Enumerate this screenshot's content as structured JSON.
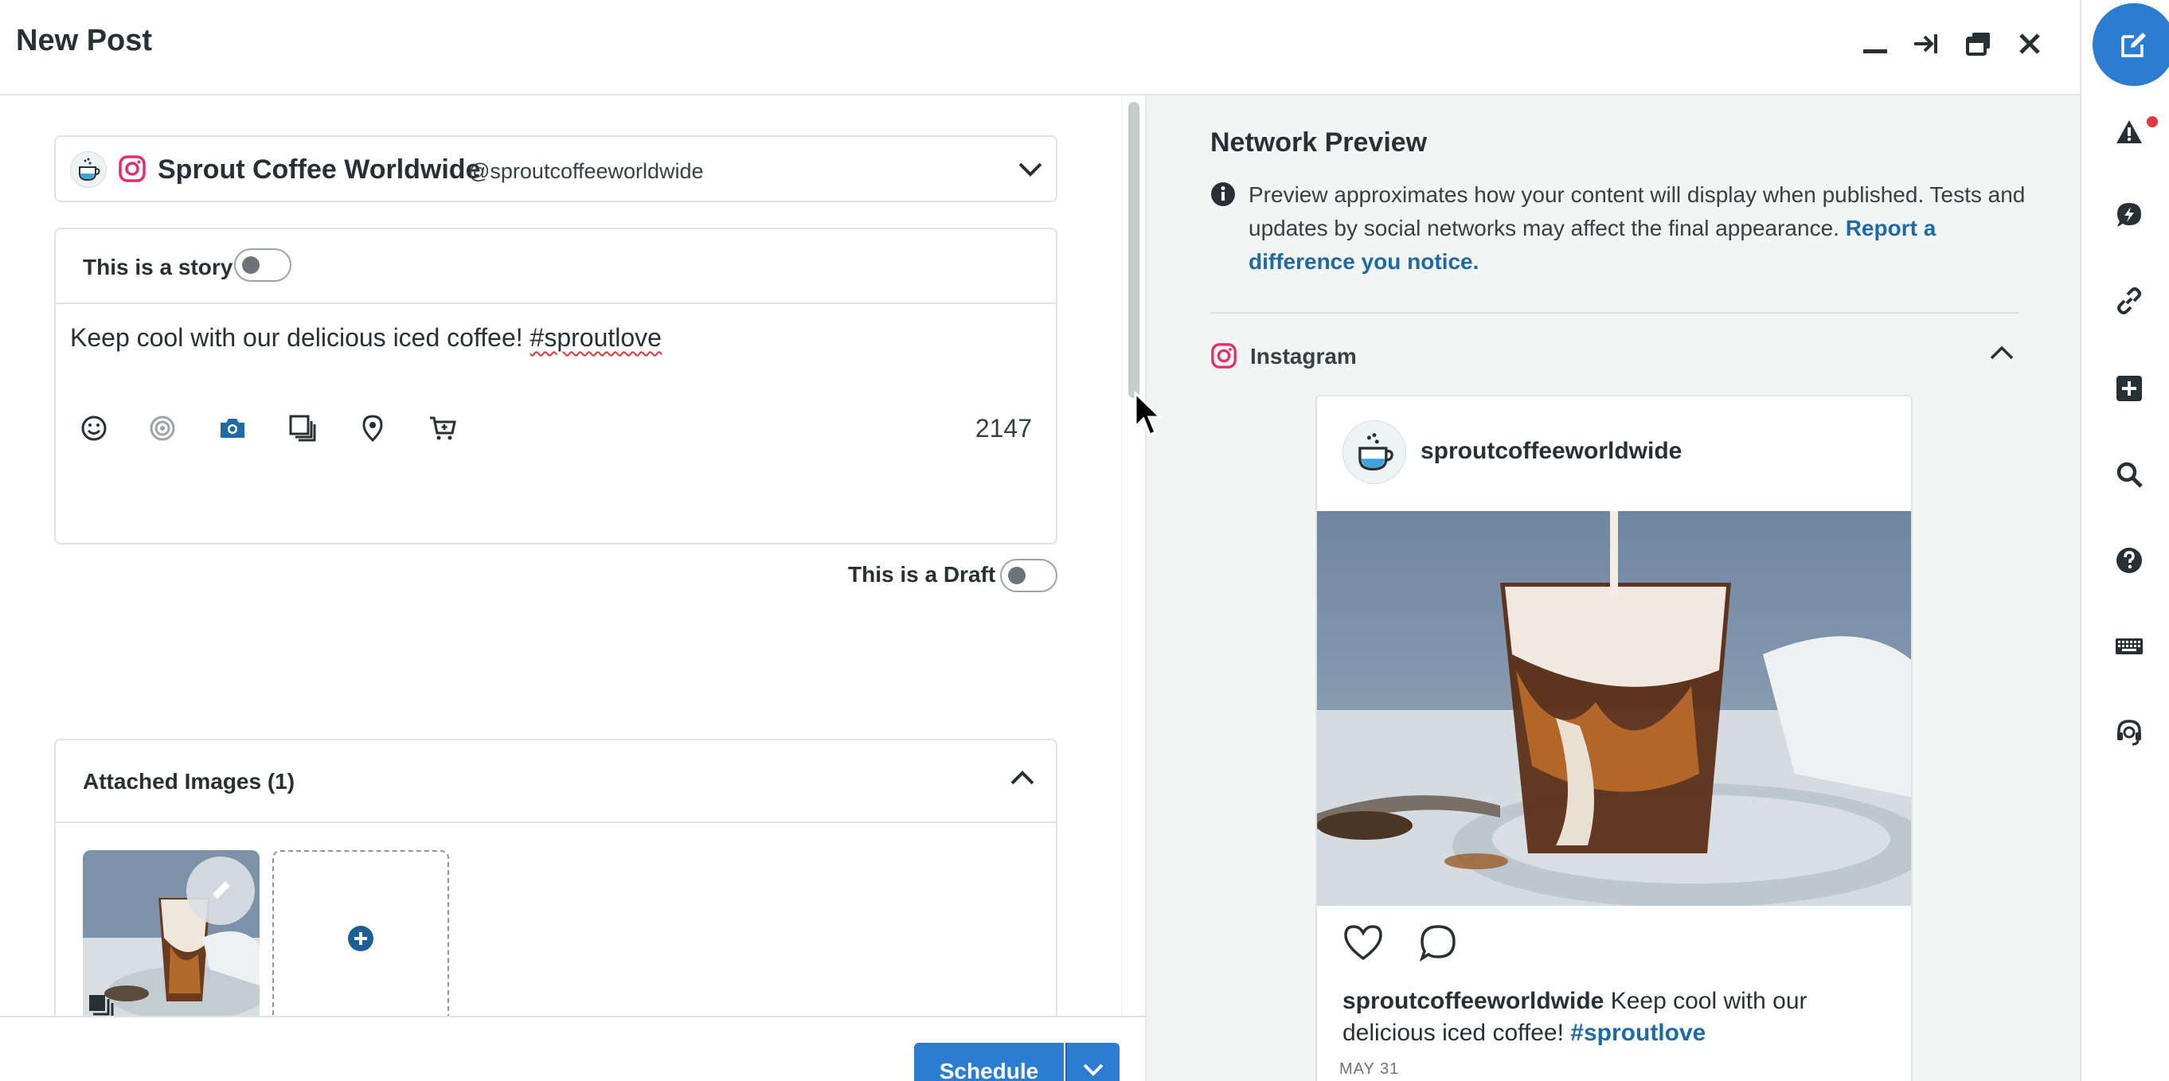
{
  "header": {
    "title": "New Post"
  },
  "profile": {
    "name": "Sprout Coffee Worldwide",
    "handle": "@sproutcoffeeworldwide"
  },
  "composer": {
    "story_label": "This is a story",
    "text_before": "Keep cool with our delicious iced coffee! ",
    "hashtag": "#sproutlove",
    "char_count": "2147"
  },
  "draft": {
    "label": "This is a Draft"
  },
  "attached": {
    "label": "Attached Images (1)"
  },
  "footer": {
    "schedule_label": "Schedule"
  },
  "preview": {
    "title": "Network Preview",
    "info_text": "Preview approximates how your content will display when published. Tests and updates by social networks may affect the final appearance. ",
    "info_link": "Report a difference you notice.",
    "network_label": "Instagram",
    "post": {
      "username": "sproutcoffeeworldwide",
      "caption_user": "sproutcoffeeworldwide",
      "caption_text": " Keep cool with our delicious iced coffee! ",
      "caption_tag": "#sproutlove",
      "date": "MAY 31"
    }
  },
  "colors": {
    "accent": "#2b7dd1",
    "link": "#1d6aa5",
    "instagram": "#e1306c",
    "alert_dot": "#e03a3a"
  }
}
